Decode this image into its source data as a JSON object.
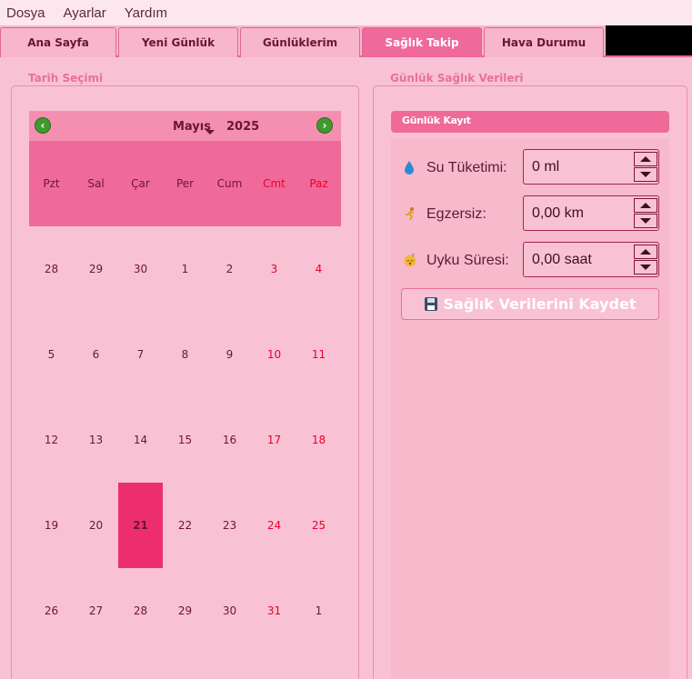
{
  "menu": [
    "Dosya",
    "Ayarlar",
    "Yardım"
  ],
  "tabs": [
    {
      "label": "Ana Sayfa"
    },
    {
      "label": "Yeni Günlük"
    },
    {
      "label": "Günlüklerim"
    },
    {
      "label": "Sağlık Takip"
    },
    {
      "label": "Hava Durumu"
    }
  ],
  "active_tab": "Sağlık Takip",
  "date_group": {
    "title": "Tarih Seçimi"
  },
  "calendar": {
    "month": "Mayıs",
    "year": "2025",
    "weekdays": [
      "Pzt",
      "Sal",
      "Çar",
      "Per",
      "Cum",
      "Cmt",
      "Paz"
    ],
    "weeks": [
      [
        "28",
        "29",
        "30",
        "1",
        "2",
        "3",
        "4"
      ],
      [
        "5",
        "6",
        "7",
        "8",
        "9",
        "10",
        "11"
      ],
      [
        "12",
        "13",
        "14",
        "15",
        "16",
        "17",
        "18"
      ],
      [
        "19",
        "20",
        "21",
        "22",
        "23",
        "24",
        "25"
      ],
      [
        "26",
        "27",
        "28",
        "29",
        "30",
        "31",
        "1"
      ]
    ],
    "selected_day": "21"
  },
  "health_group": {
    "title": "Günlük Sağlık Verileri",
    "subheader": "Günlük Kayıt",
    "water_label": "Su Tüketimi:",
    "water_value": "0 ml",
    "exercise_label": "Egzersiz:",
    "exercise_value": "0,00 km",
    "sleep_label": "Uyku Süresi:",
    "sleep_value": "0,00 saat",
    "save_label": "Sağlık Verilerini Kaydet"
  },
  "icons": {
    "water": "water-drop-icon",
    "exercise": "running-icon",
    "sleep": "sleeping-face-icon",
    "save": "floppy-disk-icon",
    "prev": "arrow-left-icon",
    "next": "arrow-right-icon"
  },
  "colors": {
    "background": "#f9c2d4",
    "accent": "#f06a99",
    "selected_day": "#ed2e6e",
    "weekend": "#e8002a"
  }
}
